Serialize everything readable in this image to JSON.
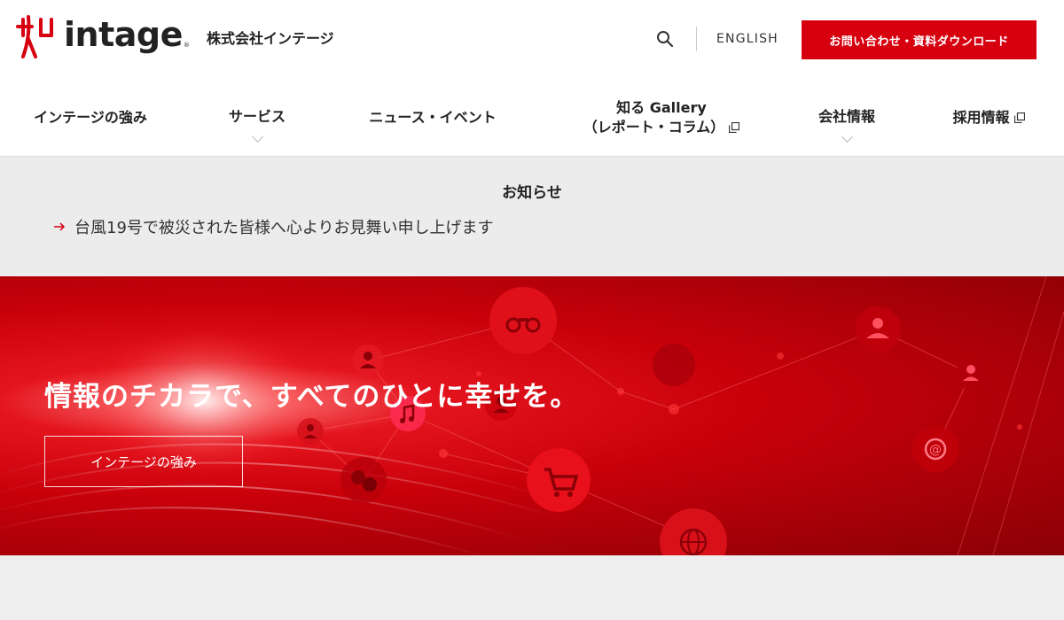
{
  "brand": {
    "logo_text": "intage",
    "logo_registered": "®",
    "company_name": "株式会社インテージ",
    "logo_color": "#d7000f"
  },
  "header": {
    "search_icon": "search-icon",
    "english_label": "ENGLISH",
    "contact_label": "お問い合わせ・資料ダウンロード",
    "accent_color": "#d7000f"
  },
  "nav": {
    "items": [
      {
        "label": "インテージの強み",
        "has_dropdown": false,
        "external": false
      },
      {
        "label": "サービス",
        "has_dropdown": true,
        "external": false
      },
      {
        "label": "ニュース・イベント",
        "has_dropdown": false,
        "external": false
      },
      {
        "label": "知る Gallery",
        "label2": "（レポート・コラム）",
        "has_dropdown": false,
        "external": true
      },
      {
        "label": "会社情報",
        "has_dropdown": true,
        "external": false
      },
      {
        "label": "採用情報",
        "has_dropdown": false,
        "external": true
      }
    ]
  },
  "notice": {
    "title": "お知らせ",
    "items": [
      {
        "text": "台風19号で被災された皆様へ心よりお見舞い申し上げます"
      }
    ]
  },
  "hero": {
    "headline": "情報のチカラで、すべてのひとに幸せを。",
    "button_label": "インテージの強み",
    "icons": [
      "binoculars-icon",
      "person-icon",
      "music-icon",
      "cart-icon",
      "globe-icon",
      "at-sign-icon",
      "drama-masks-icon"
    ]
  }
}
